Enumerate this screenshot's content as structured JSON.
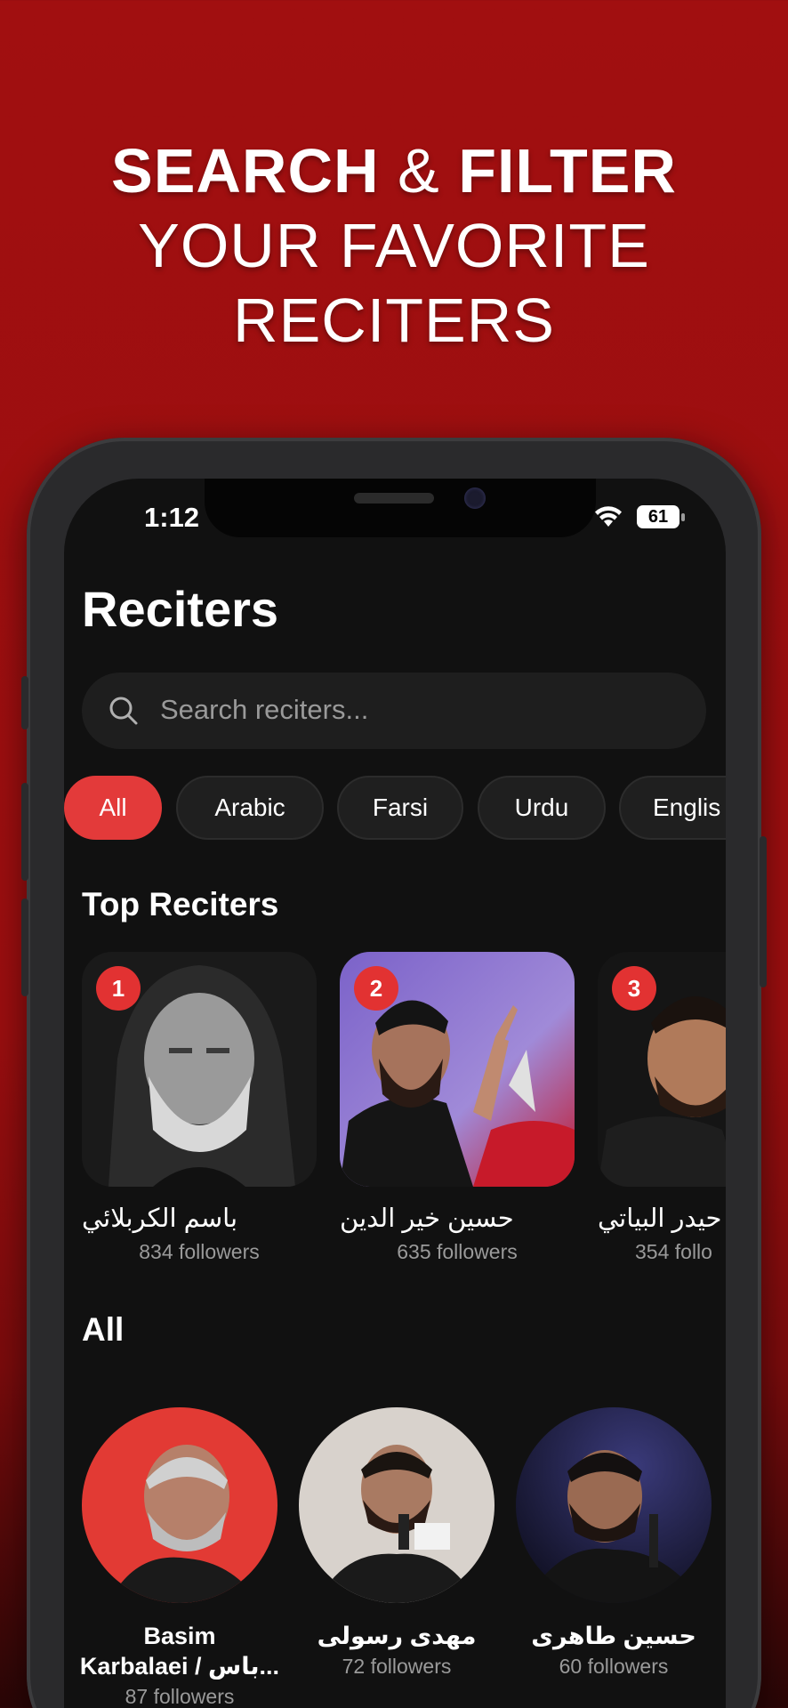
{
  "promo": {
    "line1_bold_a": "SEARCH",
    "line1_amp": "&",
    "line1_bold_b": "FILTER",
    "line2": "YOUR FAVORITE",
    "line3": "RECITERS"
  },
  "status_bar": {
    "time": "1:12",
    "battery": "61"
  },
  "page": {
    "title": "Reciters"
  },
  "search": {
    "placeholder": "Search reciters...",
    "icon": "search-icon"
  },
  "filters": [
    {
      "label": "All",
      "active": true
    },
    {
      "label": "Arabic",
      "active": false
    },
    {
      "label": "Farsi",
      "active": false
    },
    {
      "label": "Urdu",
      "active": false
    },
    {
      "label": "Englis",
      "active": false
    }
  ],
  "top_section": {
    "title": "Top Reciters"
  },
  "top_reciters": [
    {
      "rank": "1",
      "name": "باسم الكربلائي",
      "followers": "834 followers"
    },
    {
      "rank": "2",
      "name": "حسين خير الدين",
      "followers": "635 followers"
    },
    {
      "rank": "3",
      "name": "حيدر البياتي",
      "followers": "354 follo"
    }
  ],
  "all_section": {
    "title": "All"
  },
  "all_reciters": [
    {
      "name_line1": "Basim",
      "name_line2": "Karbalaei / باس...",
      "followers": "87 followers"
    },
    {
      "name_line1": "مهدی رسولی",
      "followers": "72 followers"
    },
    {
      "name_line1": "حسین طاهری",
      "followers": "60 followers"
    }
  ],
  "colors": {
    "accent": "#e33a3a",
    "background": "#a10f10",
    "screen": "#111111"
  }
}
